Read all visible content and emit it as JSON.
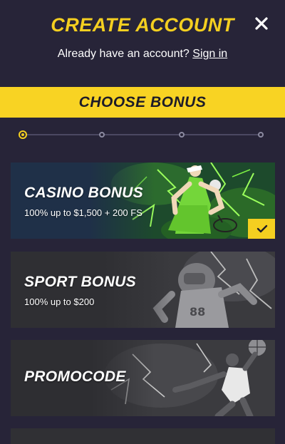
{
  "header": {
    "title": "CREATE ACCOUNT",
    "prompt": "Already have an account?",
    "sign_in": "Sign in"
  },
  "banner": {
    "label": "CHOOSE BONUS"
  },
  "stepper": {
    "steps": 4,
    "active": 1
  },
  "cards": [
    {
      "title": "CASINO BONUS",
      "description": "100% up to $1,500 + 200 FS",
      "selected": true
    },
    {
      "title": "SPORT BONUS",
      "description": "100% up to $200",
      "selected": false
    },
    {
      "title": "PROMOCODE",
      "selected": false
    }
  ],
  "colors": {
    "background": "#272438",
    "accent": "#f4cf20",
    "casino_card": "#1f3048",
    "neon_green": "#5de22c"
  },
  "icons": [
    "close-icon",
    "check-icon"
  ]
}
